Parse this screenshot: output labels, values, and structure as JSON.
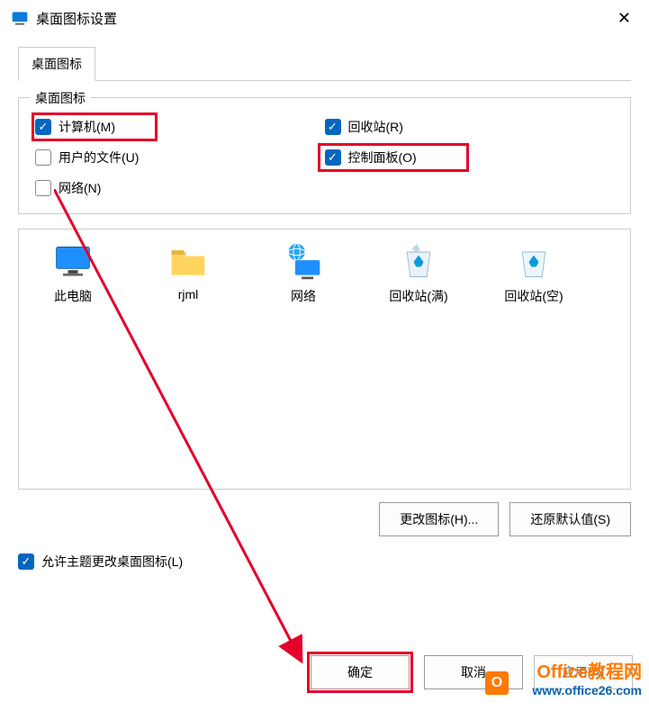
{
  "title": "桌面图标设置",
  "tabs": {
    "main": "桌面图标"
  },
  "group": {
    "legend": "桌面图标",
    "computer": "计算机(M)",
    "userfiles": "用户的文件(U)",
    "network": "网络(N)",
    "recyclebin": "回收站(R)",
    "controlpanel": "控制面板(O)"
  },
  "icons": {
    "thispc": "此电脑",
    "rjml": "rjml",
    "net": "网络",
    "recycle_full": "回收站(满)",
    "recycle_empty": "回收站(空)"
  },
  "buttons": {
    "change_icon": "更改图标(H)...",
    "restore_default": "还原默认值(S)",
    "ok": "确定",
    "cancel": "取消",
    "apply": "应用(A)"
  },
  "allow_themes": "允许主题更改桌面图标(L)",
  "watermark": {
    "line1": "Office教程网",
    "line2": "www.office26.com"
  }
}
